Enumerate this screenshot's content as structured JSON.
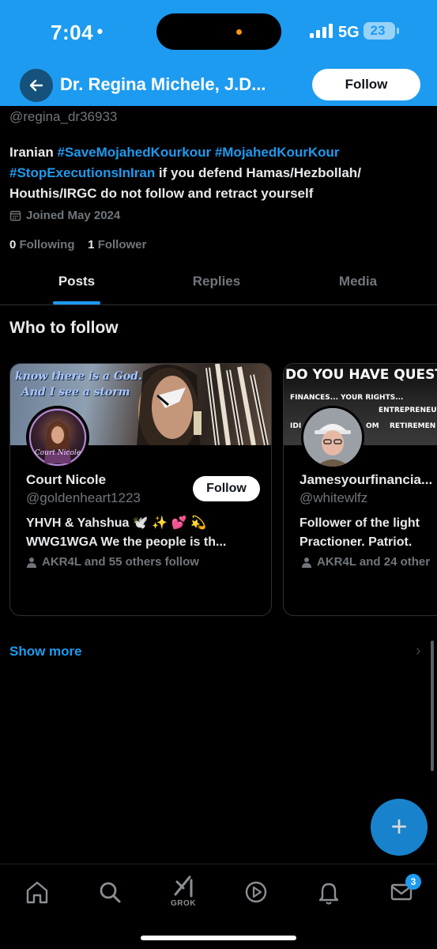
{
  "status_bar": {
    "time": "7:04",
    "network": "5G",
    "battery": "23"
  },
  "header": {
    "title": "Dr. Regina Michele, J.D...",
    "follow_label": "Follow"
  },
  "profile": {
    "handle": "@regina_dr36933",
    "bio_segments": [
      {
        "text": "Iranian ",
        "type": "text"
      },
      {
        "text": "#SaveMojahedKourkour",
        "type": "hashtag"
      },
      {
        "text": " ",
        "type": "text"
      },
      {
        "text": "#MojahedKourKour",
        "type": "hashtag"
      },
      {
        "text": " ",
        "type": "text"
      },
      {
        "text": "#StopExecutionsInIran",
        "type": "hashtag"
      },
      {
        "text": " if you defend Hamas/Hezbollah/ Houthis/IRGC do not follow and retract yourself",
        "type": "text"
      }
    ],
    "joined": "Joined May 2024",
    "following_count": "0",
    "following_label": "Following",
    "followers_count": "1",
    "followers_label": "Follower"
  },
  "tabs": [
    {
      "label": "Posts",
      "active": true
    },
    {
      "label": "Replies",
      "active": false
    },
    {
      "label": "Media",
      "active": false
    }
  ],
  "who_to_follow": {
    "title": "Who to follow",
    "cards": [
      {
        "banner_text_1": "know there is a God.",
        "banner_text_2": "And I see a storm",
        "avatar_text": "Court Nicole",
        "name": "Court Nicole",
        "handle": "@goldenheart1223",
        "follow_label": "Follow",
        "bio_line_1": "YHVH & Yahshua 🕊️ ✨ 💕 💫",
        "bio_line_2": "WWG1WGA We the people is th...",
        "social": "AKR4L and 55 others follow"
      },
      {
        "banner_text_1": "DO YOU HAVE QUESTIO",
        "banner_text_2": "FINANCES... YOUR RIGHTS...",
        "banner_text_3": "ENTREPRENEU",
        "banner_text_4": "IDI",
        "banner_text_5": "OM",
        "banner_text_6": "RETIREMEN",
        "name": "Jamesyourfinancia...",
        "handle": "@whitewlfz",
        "bio_line_1": "Follower of the light",
        "bio_line_2": "Practioner. Patriot.",
        "social": "AKR4L and 24 other"
      }
    ],
    "show_more": "Show more"
  },
  "bottom_nav": {
    "grok_label": "GROK",
    "messages_badge": "3"
  },
  "colors": {
    "accent": "#1d9bf0",
    "background": "#000000",
    "muted": "#71767b"
  }
}
